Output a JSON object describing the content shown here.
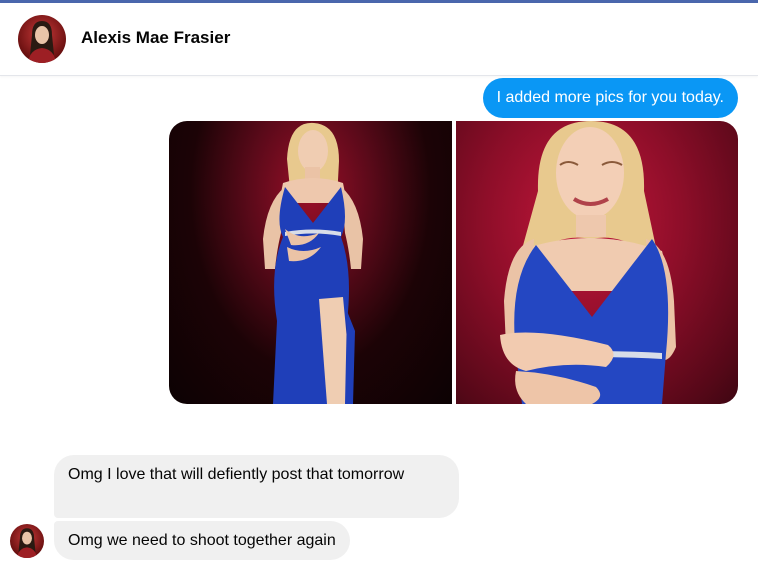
{
  "header": {
    "contact_name": "Alexis Mae Frasier"
  },
  "messages": {
    "outgoing_text": "I added more pics for you today.",
    "incoming": [
      "Omg I love that will defiently post that tomorrow",
      "Omg we need to shoot together again"
    ]
  },
  "colors": {
    "outgoing_bubble": "#0a97f5",
    "incoming_bubble": "#f0f0f0",
    "top_accent": "#4a67ad"
  }
}
